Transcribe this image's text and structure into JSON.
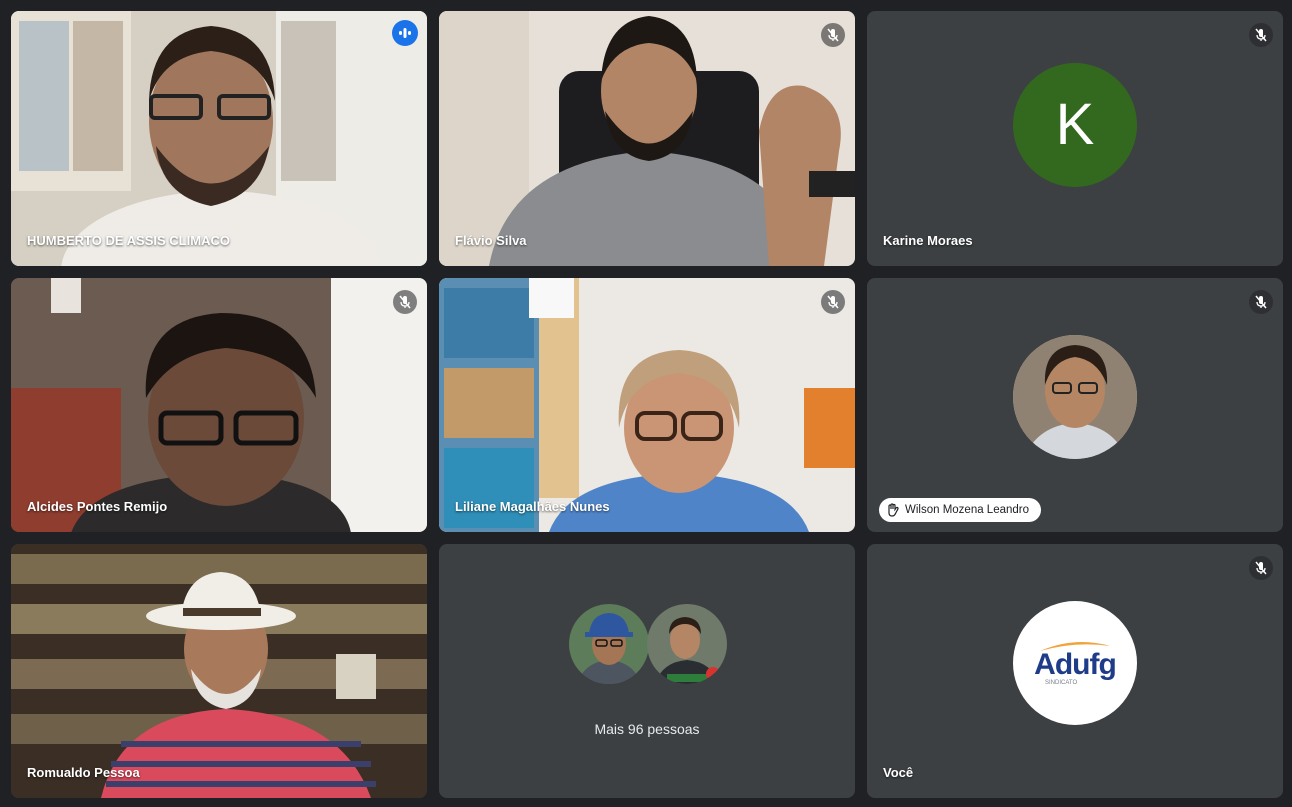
{
  "participants": [
    {
      "name": "HUMBERTO DE ASSIS CLIMACO",
      "state": "speaking"
    },
    {
      "name": "Flávio Silva",
      "state": "muted"
    },
    {
      "name": "Karine Moraes",
      "state": "muted",
      "initial": "K",
      "avatar_color": "#33691e"
    },
    {
      "name": "Alcides Pontes Remijo",
      "state": "muted"
    },
    {
      "name": "Liliane Magalhães Nunes",
      "state": "muted"
    },
    {
      "name": "Wilson Mozena Leandro",
      "state": "muted",
      "hand_raised": true
    },
    {
      "name": "Romualdo Pessoa",
      "state": "unmuted"
    },
    {
      "name": "Você",
      "state": "muted"
    }
  ],
  "overflow": {
    "label": "Mais 96 pessoas"
  },
  "self_logo": {
    "text": "Adufg",
    "subtext": "SINDICATO"
  },
  "colors": {
    "background": "#202124",
    "tile": "#3c4043",
    "active_border": "#8ab4f8",
    "speaking": "#1a73e8"
  }
}
